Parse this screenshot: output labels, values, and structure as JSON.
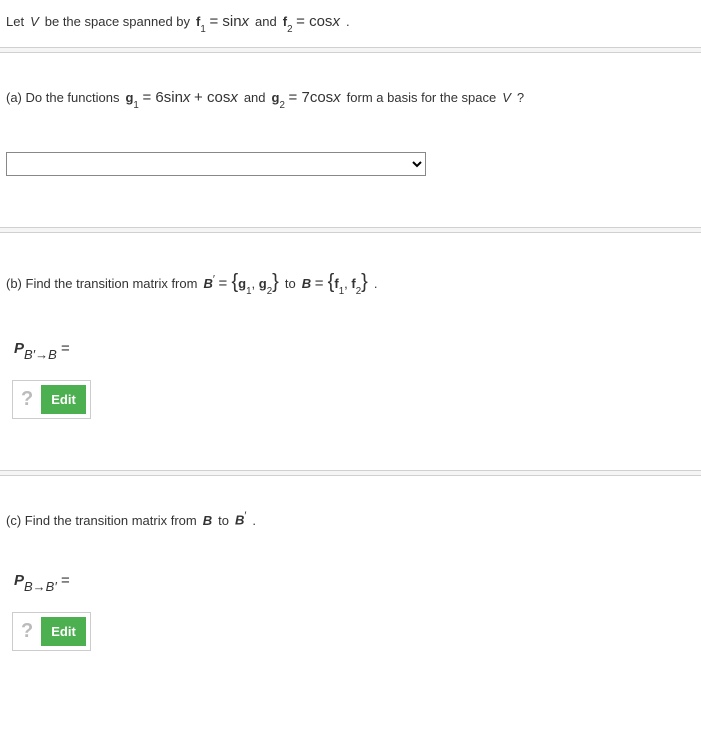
{
  "intro": {
    "prefix": "Let ",
    "v": "V",
    "spanned": " be the space spanned by ",
    "f1_sym": "f",
    "f1_sub": "1",
    "f1_eq": " = sin",
    "f1_var": "x",
    "and1": " and ",
    "f2_sym": "f",
    "f2_sub": "2",
    "f2_eq": " = cos",
    "f2_var": "x",
    "period": " ."
  },
  "part_a": {
    "label": "(a) Do the functions ",
    "g1_sym": "g",
    "g1_sub": "1",
    "g1_eq": " = 6sin",
    "g1_var": "x",
    "g1_plus": " + cos",
    "g1_var2": "x",
    "and": " and ",
    "g2_sym": "g",
    "g2_sub": "2",
    "g2_eq": " = 7cos",
    "g2_var": "x",
    "tail": " form a basis for the space ",
    "v": "V",
    "q": "?"
  },
  "part_b": {
    "label": "(b) Find the transition matrix from ",
    "bprime": "B",
    "bprime_sup": "′",
    "eq": " = ",
    "lb": "{",
    "g1": "g",
    "g1s": "1",
    "comma": ", ",
    "g2": "g",
    "g2s": "2",
    "rb": "}",
    "to": " to ",
    "b": "B",
    "eq2": " = ",
    "lb2": "{",
    "f1": "f",
    "f1s": "1",
    "comma2": ", ",
    "f2": "f",
    "f2s": "2",
    "rb2": "}",
    "period": " .",
    "matrix_p": "P",
    "matrix_sub": "B′→B",
    "matrix_eq": " = "
  },
  "part_c": {
    "label": "(c) Find the transition matrix from ",
    "b": "B",
    "to": " to ",
    "bprime": "B",
    "bprime_sup": "′",
    "period": " .",
    "matrix_p": "P",
    "matrix_sub": "B→B′",
    "matrix_eq": " = "
  },
  "buttons": {
    "edit": "Edit",
    "help": "?"
  }
}
